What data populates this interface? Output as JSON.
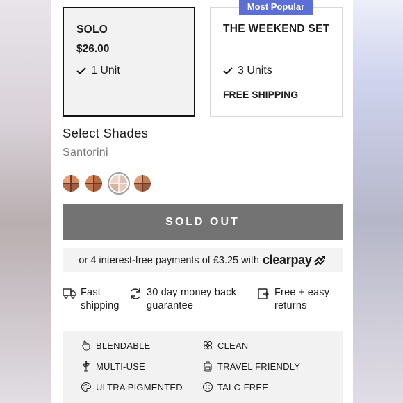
{
  "badge": {
    "label": "Most Popular"
  },
  "plans": {
    "solo": {
      "title": "SOLO",
      "price": "$26.00",
      "units": "1 Unit"
    },
    "weekend": {
      "title": "THE WEEKEND SET",
      "units": "3 Units",
      "shipping": "FREE SHIPPING"
    }
  },
  "shades": {
    "title": "Select Shades",
    "selected": "Santorini",
    "swatches": [
      {
        "colors": [
          "#e8a37e",
          "#d9875f",
          "#b8694c",
          "#a35a44"
        ]
      },
      {
        "colors": [
          "#d98a5c",
          "#b86a46",
          "#c27850",
          "#a85a3a"
        ]
      },
      {
        "colors": [
          "#efd3c6",
          "#e4c0b0",
          "#d9b3a2",
          "#e8c9bb"
        ]
      },
      {
        "colors": [
          "#e2a27a",
          "#c4825c",
          "#b87352",
          "#9a5a40"
        ]
      }
    ]
  },
  "cta": {
    "label": "SOLD OUT"
  },
  "clearpay": {
    "text": "or 4 interest-free payments of £3.25 with",
    "brand": "clearpay"
  },
  "perks": [
    {
      "line1": "Fast",
      "line2": "shipping",
      "icon": "truck-icon"
    },
    {
      "line1": "30 day money back",
      "line2": "guarantee",
      "icon": "refresh-icon"
    },
    {
      "line1": "Free + easy",
      "line2": "returns",
      "icon": "return-box-icon"
    }
  ],
  "features": [
    {
      "label": "BLENDABLE",
      "icon": "hand-icon"
    },
    {
      "label": "CLEAN",
      "icon": "flower-icon"
    },
    {
      "label": "MULTI-USE",
      "icon": "plant-icon"
    },
    {
      "label": "TRAVEL FRIENDLY",
      "icon": "backpack-icon"
    },
    {
      "label": "ULTRA PIGMENTED",
      "icon": "palette-icon"
    },
    {
      "label": "TALC-FREE",
      "icon": "powder-icon"
    }
  ],
  "colors": {
    "badge": "#5b6fd6",
    "sold_out": "#737373",
    "muted": "#777777"
  }
}
